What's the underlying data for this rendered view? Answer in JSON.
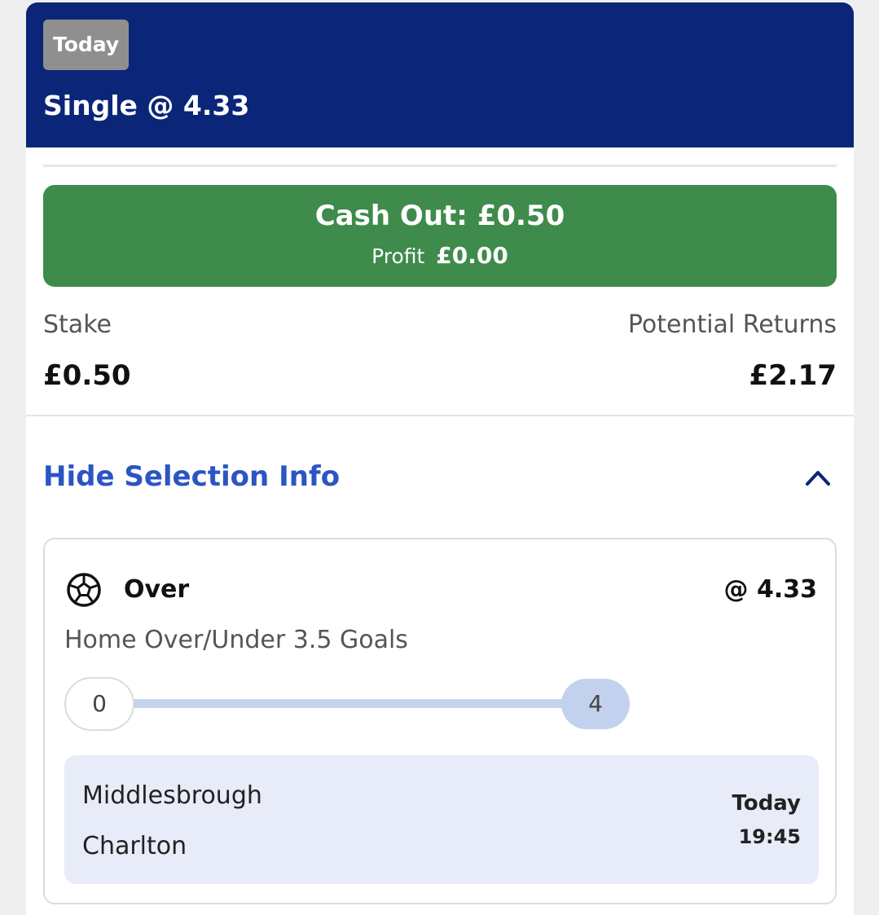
{
  "header": {
    "badge": "Today",
    "title": "Single @ 4.33"
  },
  "cashout": {
    "label": "Cash Out: £0.50",
    "profit_label": "Profit",
    "profit_value": "£0.00",
    "color": "#3e8b4b"
  },
  "stake": {
    "label": "Stake",
    "value": "£0.50"
  },
  "returns": {
    "label": "Potential Returns",
    "value": "£2.17"
  },
  "selection_toggle": {
    "label": "Hide Selection Info",
    "icon": "chevron-up-icon"
  },
  "selection": {
    "sport_icon": "football-icon",
    "name": "Over",
    "odds": "@ 4.33",
    "market": "Home Over/Under 3.5 Goals",
    "progress": {
      "start": "0",
      "end": "4"
    },
    "match": {
      "home": "Middlesbrough",
      "away": "Charlton",
      "day": "Today",
      "time": "19:45"
    }
  },
  "colors": {
    "header_bg": "#0b2578",
    "link": "#2b55c4"
  }
}
